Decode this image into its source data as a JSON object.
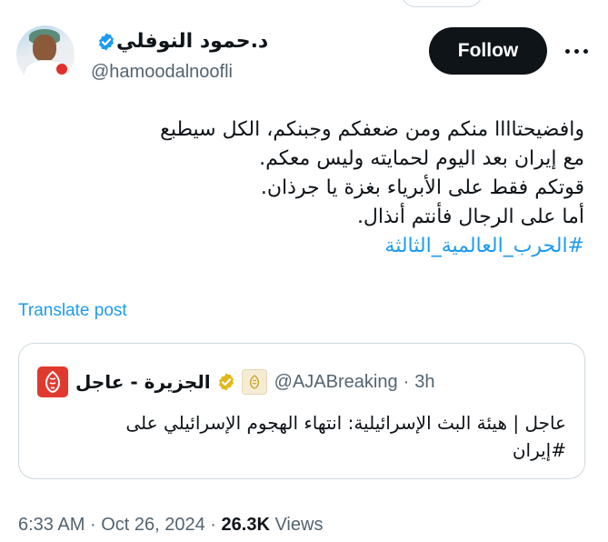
{
  "author": {
    "name": "د.حمود النوفلي",
    "handle": "@hamoodalnoofli",
    "verified_color": "#1d9bf0"
  },
  "actions": {
    "follow_label": "Follow",
    "more_icon": "more-horizontal-icon"
  },
  "tweet": {
    "lines": [
      "وافضيحتاااا منكم ومن ضعفكم وجبنكم، الكل سيطبع",
      "مع إيران بعد اليوم لحمايته وليس معكم.",
      "قوتكم فقط على الأبرياء بغزة يا جرذان.",
      "أما على الرجال فأنتم أنذال."
    ],
    "hashtag": "#الحرب_العالمية_الثالثة",
    "translate_label": "Translate post"
  },
  "quote": {
    "name": "الجزيرة - عاجل",
    "handle": "@AJABreaking",
    "separator": "·",
    "time": "3h",
    "badge_color": "#e2b719",
    "logo_color": "#e03a2f",
    "text_line1": "عاجل | هيئة البث الإسرائيلية: انتهاء الهجوم الإسرائيلي على",
    "text_line2": "#إيران"
  },
  "meta": {
    "time": "6:33 AM",
    "separator": "·",
    "date": "Oct 26, 2024",
    "views_count": "26.3K",
    "views_label": "Views"
  },
  "colors": {
    "accent": "#1d9bf0",
    "text": "#0f1419",
    "muted": "#536471",
    "border": "#cfd9de"
  }
}
